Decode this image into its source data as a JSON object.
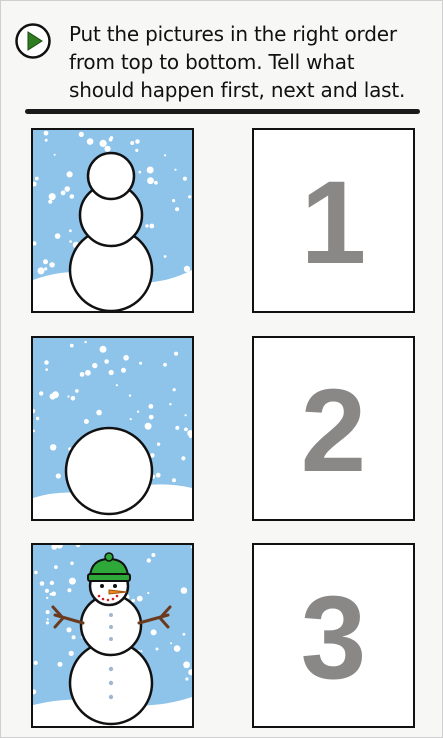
{
  "instructions": {
    "line1": "Put the pictures in the right order",
    "line2": "from top to bottom. Tell what",
    "line3": "should happen first, next and last."
  },
  "play_button": {
    "icon": "play-icon",
    "color": "#2e7d1e"
  },
  "pictures": [
    {
      "name": "snowman-body-no-face",
      "icon": "snowman-icon"
    },
    {
      "name": "snowball",
      "icon": "snowball-icon"
    },
    {
      "name": "finished-snowman",
      "icon": "snowman-with-hat-icon"
    }
  ],
  "slots": [
    {
      "number": "1"
    },
    {
      "number": "2"
    },
    {
      "number": "3"
    }
  ],
  "colors": {
    "sky": "#8ec3ea",
    "snow": "#ffffff",
    "hat": "#2fa83a",
    "number": "#8a8787"
  }
}
